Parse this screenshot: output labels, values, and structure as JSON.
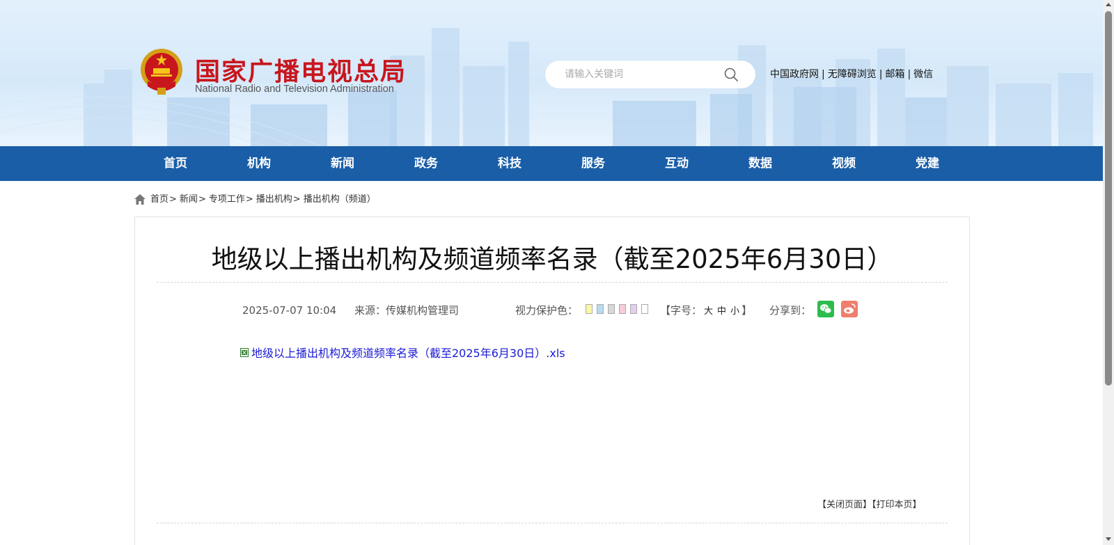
{
  "header": {
    "site_name_cn": "国家广播电视总局",
    "site_name_en": "National Radio and Television Administration",
    "search_placeholder": "请输入关键词",
    "top_links": [
      "中国政府网",
      "无障碍浏览",
      "邮箱",
      "微信"
    ]
  },
  "nav": {
    "items": [
      "首页",
      "机构",
      "新闻",
      "政务",
      "科技",
      "服务",
      "互动",
      "数据",
      "视频",
      "党建"
    ]
  },
  "breadcrumb": {
    "items": [
      "首页",
      "新闻",
      "专项工作",
      "播出机构",
      "播出机构（频道）"
    ],
    "separator": ">"
  },
  "article": {
    "title": "地级以上播出机构及频道频率名录（截至2025年6月30日）",
    "date": "2025-07-07 10:04",
    "source": "来源：传媒机构管理司",
    "eye_protection_label": "视力保护色：",
    "eye_colors": [
      "#fbf6a8",
      "#b6dcf0",
      "#d8d8d8",
      "#f6cdd8",
      "#e3cdf0",
      "#ffffff"
    ],
    "font_size_prefix": "【字号：",
    "font_size_options": [
      "大",
      "中",
      "小"
    ],
    "font_size_suffix": "】",
    "share_label": "分享到：",
    "attachment": "地级以上播出机构及频道频率名录（截至2025年6月30日）.xls",
    "close_page": "【关闭页面】",
    "print_page": "【打印本页】"
  },
  "colors": {
    "nav_bg": "#1a5ea8",
    "title_red": "#c8161d",
    "link_blue": "#1a1ad6",
    "wechat_green": "#2dbc4e",
    "weibo_orange": "#f07e6d"
  }
}
